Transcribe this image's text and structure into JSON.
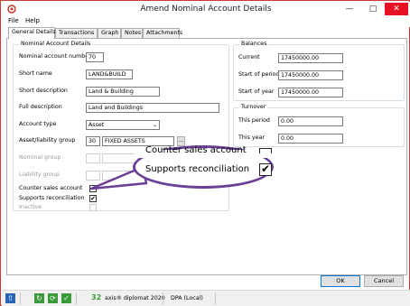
{
  "window": {
    "title": "Amend Nominal Account Details",
    "minimize_glyph": "—",
    "maximize_glyph": "□",
    "close_glyph": "✕"
  },
  "menu": [
    "File",
    "Help"
  ],
  "tabs": [
    "General Details",
    "Transactions",
    "Graph",
    "Notes",
    "Attachments"
  ],
  "nominal_details": {
    "group_title": "Nominal Account Details",
    "account_number_label": "Nominal account number",
    "account_number": "70",
    "short_name_label": "Short name",
    "short_name": "LAND&BUILD",
    "short_description_label": "Short description",
    "short_description": "Land & Building",
    "full_description_label": "Full description",
    "full_description": "Land and Buildings",
    "account_type_label": "Account type",
    "account_type": "Asset",
    "asset_liability_group_label": "Asset/liability group",
    "asset_liability_group_code": "30",
    "asset_liability_group_name": "FIXED ASSETS",
    "lookup_button": "...",
    "nominal_group_label": "Nominal group",
    "liability_group_label": "Liability group",
    "counter_sales_label": "Counter sales account",
    "supports_reconciliation_label": "Supports reconciliation",
    "inactive_label": "Inactive",
    "counter_sales_checked": false,
    "supports_reconciliation_checked": true,
    "inactive_checked": false,
    "check_glyph": "✔"
  },
  "balances": {
    "group_title": "Balances",
    "current_label": "Current",
    "current": "17450000.00",
    "start_period_label": "Start of period",
    "start_period": "17450000.00",
    "start_year_label": "Start of year",
    "start_year": "17450000.00"
  },
  "turnover": {
    "group_title": "Turnover",
    "this_period_label": "This period",
    "this_period": "0.00",
    "this_year_label": "This year",
    "this_year": "0.00"
  },
  "callout": {
    "counter_sales_label": "Counter sales account",
    "supports_reconciliation_label": "Supports reconciliation",
    "check_glyph": "✔"
  },
  "buttons": {
    "ok": "OK",
    "cancel": "Cancel"
  },
  "statusbar": {
    "count": "32",
    "product": "axis® diplomat 2020",
    "database": "DPA (Local)",
    "colors": {
      "green": "#3a9a3a",
      "blue": "#2a64b8"
    }
  }
}
